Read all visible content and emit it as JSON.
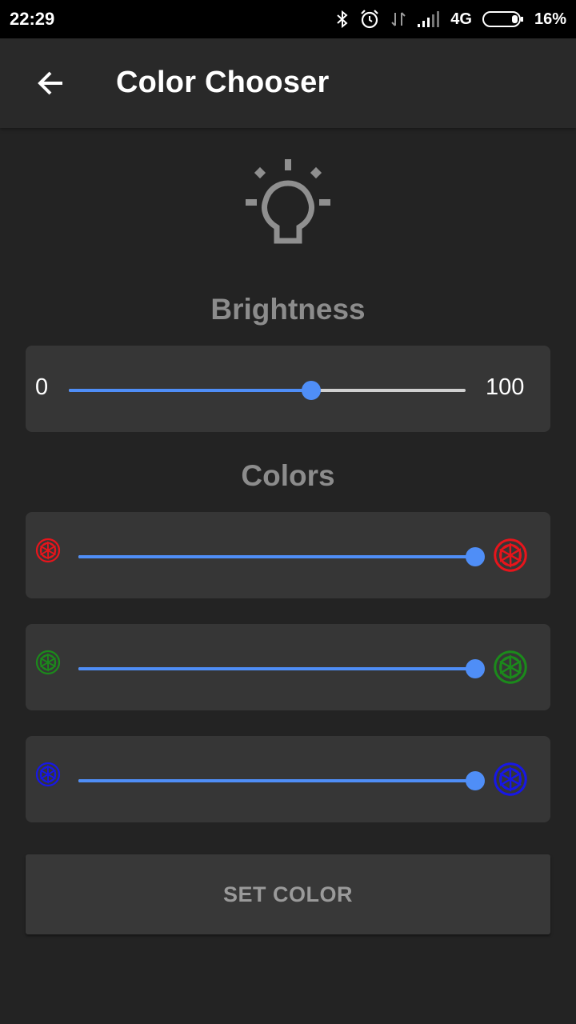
{
  "status_bar": {
    "time": "22:29",
    "network": "4G",
    "battery": "16%",
    "icons": [
      "bluetooth-icon",
      "alarm-icon",
      "data-transfer-icon",
      "signal-icon",
      "battery-icon"
    ]
  },
  "app_bar": {
    "title": "Color Chooser",
    "back_icon": "arrow-left-icon"
  },
  "header_icon": "lightbulb-icon",
  "brightness": {
    "label": "Brightness",
    "min_label": "0",
    "max_label": "100",
    "value_fraction": 0.61
  },
  "colors": {
    "label": "Colors",
    "sliders": [
      {
        "name": "red",
        "color": "#e8141b",
        "value_fraction": 1.0
      },
      {
        "name": "green",
        "color": "#1b8a1b",
        "value_fraction": 1.0
      },
      {
        "name": "blue",
        "color": "#1717e6",
        "value_fraction": 1.0
      }
    ]
  },
  "accent_color": "#4f8ef7",
  "set_color_button": "SET COLOR"
}
